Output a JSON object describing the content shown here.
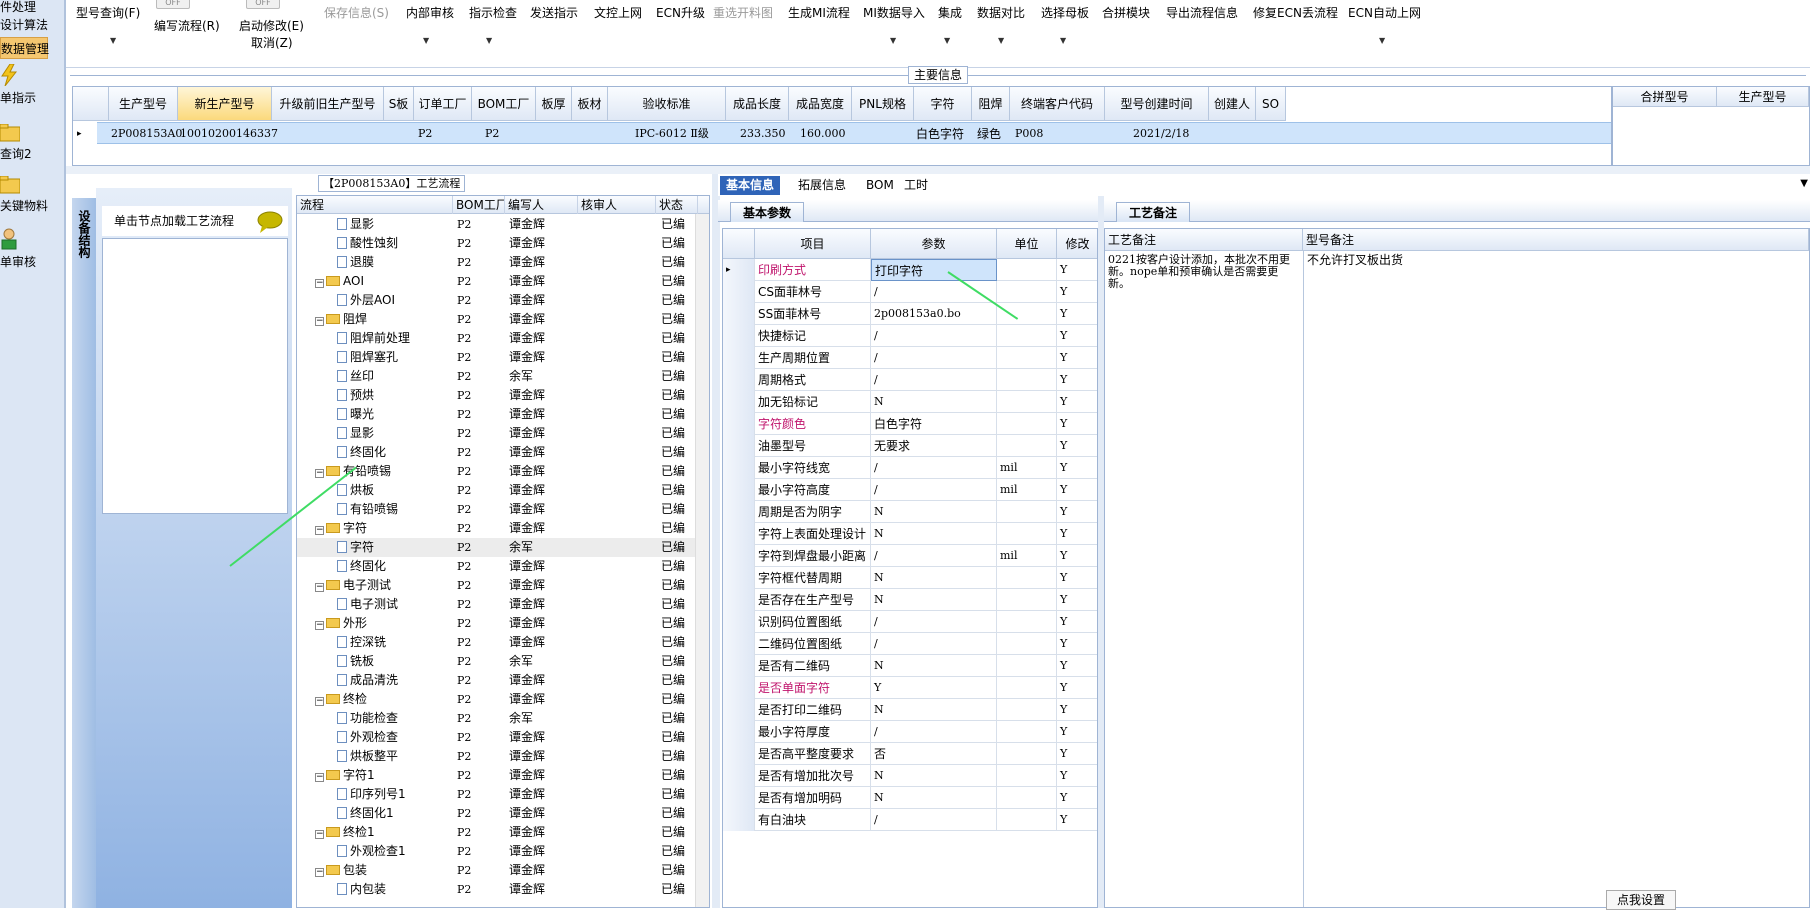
{
  "nav": {
    "items": [
      "件处理",
      "设计算法",
      "数据管理",
      "单指示",
      "查询2",
      "关键物料",
      "单审核"
    ]
  },
  "toolbar": {
    "buttons": [
      "型号查询(F)",
      "编写流程(R)",
      "启动修改(E)",
      "取消(Z)",
      "保存信息(S)",
      "内部审核",
      "指示检查",
      "发送指示",
      "文控上网",
      "ECN升级",
      "重选开料图",
      "生成MI流程",
      "MI数据导入",
      "集成",
      "数据对比",
      "选择母板",
      "合拼模块",
      "导出流程信息",
      "修复ECN丢流程",
      "ECN自动上网"
    ],
    "toggle": "OFF"
  },
  "main_info": {
    "title": "主要信息",
    "headers": [
      "生产型号",
      "新生产型号",
      "升级前旧生产型号",
      "S板",
      "订单工厂",
      "BOM工厂",
      "板厚",
      "板材",
      "验收标准",
      "成品长度",
      "成品宽度",
      "PNL规格",
      "字符",
      "阻焊",
      "终端客户代码",
      "型号创建时间",
      "创建人",
      "SO"
    ],
    "row": [
      "2P008153A0",
      "10010200146337",
      "",
      "",
      "P2",
      "P2",
      "",
      "",
      "IPC-6012 Ⅱ级",
      "233.350",
      "160.000",
      "",
      "白色字符",
      "绿色",
      "P008",
      "2021/2/18",
      "",
      ""
    ],
    "right_headers": [
      "合拼型号",
      "生产型号"
    ]
  },
  "left_panel": {
    "vertical_tab": "设备结构",
    "hint": "单击节点加载工艺流程"
  },
  "tree": {
    "caption": "【2P008153A0】工艺流程",
    "headers": [
      "流程",
      "BOM工厂",
      "编写人",
      "核审人",
      "状态"
    ],
    "rows": [
      {
        "level": 2,
        "type": "doc",
        "name": "显影",
        "bom": "P2",
        "writer": "谭金辉",
        "status": "已编"
      },
      {
        "level": 2,
        "type": "doc",
        "name": "酸性蚀刻",
        "bom": "P2",
        "writer": "谭金辉",
        "status": "已编"
      },
      {
        "level": 2,
        "type": "doc",
        "name": "退膜",
        "bom": "P2",
        "writer": "谭金辉",
        "status": "已编"
      },
      {
        "level": 1,
        "type": "folder",
        "name": "AOI",
        "bom": "P2",
        "writer": "谭金辉",
        "status": "已编"
      },
      {
        "level": 2,
        "type": "doc",
        "name": "外层AOI",
        "bom": "P2",
        "writer": "谭金辉",
        "status": "已编"
      },
      {
        "level": 1,
        "type": "folder",
        "name": "阻焊",
        "bom": "P2",
        "writer": "谭金辉",
        "status": "已编"
      },
      {
        "level": 2,
        "type": "doc",
        "name": "阻焊前处理",
        "bom": "P2",
        "writer": "谭金辉",
        "status": "已编"
      },
      {
        "level": 2,
        "type": "doc",
        "name": "阻焊塞孔",
        "bom": "P2",
        "writer": "谭金辉",
        "status": "已编"
      },
      {
        "level": 2,
        "type": "doc",
        "name": "丝印",
        "bom": "P2",
        "writer": "余军",
        "status": "已编"
      },
      {
        "level": 2,
        "type": "doc",
        "name": "预烘",
        "bom": "P2",
        "writer": "谭金辉",
        "status": "已编"
      },
      {
        "level": 2,
        "type": "doc",
        "name": "曝光",
        "bom": "P2",
        "writer": "谭金辉",
        "status": "已编"
      },
      {
        "level": 2,
        "type": "doc",
        "name": "显影",
        "bom": "P2",
        "writer": "谭金辉",
        "status": "已编"
      },
      {
        "level": 2,
        "type": "doc",
        "name": "终固化",
        "bom": "P2",
        "writer": "谭金辉",
        "status": "已编"
      },
      {
        "level": 1,
        "type": "folder",
        "name": "有铅喷锡",
        "bom": "P2",
        "writer": "谭金辉",
        "status": "已编"
      },
      {
        "level": 2,
        "type": "doc",
        "name": "烘板",
        "bom": "P2",
        "writer": "谭金辉",
        "status": "已编"
      },
      {
        "level": 2,
        "type": "doc",
        "name": "有铅喷锡",
        "bom": "P2",
        "writer": "谭金辉",
        "status": "已编"
      },
      {
        "level": 1,
        "type": "folder",
        "name": "字符",
        "bom": "P2",
        "writer": "谭金辉",
        "status": "已编"
      },
      {
        "level": 2,
        "type": "doc",
        "name": "字符",
        "bom": "P2",
        "writer": "余军",
        "status": "已编",
        "selected": true
      },
      {
        "level": 2,
        "type": "doc",
        "name": "终固化",
        "bom": "P2",
        "writer": "谭金辉",
        "status": "已编"
      },
      {
        "level": 1,
        "type": "folder",
        "name": "电子测试",
        "bom": "P2",
        "writer": "谭金辉",
        "status": "已编"
      },
      {
        "level": 2,
        "type": "doc",
        "name": "电子测试",
        "bom": "P2",
        "writer": "谭金辉",
        "status": "已编"
      },
      {
        "level": 1,
        "type": "folder",
        "name": "外形",
        "bom": "P2",
        "writer": "谭金辉",
        "status": "已编"
      },
      {
        "level": 2,
        "type": "doc",
        "name": "控深铣",
        "bom": "P2",
        "writer": "谭金辉",
        "status": "已编"
      },
      {
        "level": 2,
        "type": "doc",
        "name": "铣板",
        "bom": "P2",
        "writer": "余军",
        "status": "已编"
      },
      {
        "level": 2,
        "type": "doc",
        "name": "成品清洗",
        "bom": "P2",
        "writer": "谭金辉",
        "status": "已编"
      },
      {
        "level": 1,
        "type": "folder",
        "name": "终检",
        "bom": "P2",
        "writer": "谭金辉",
        "status": "已编"
      },
      {
        "level": 2,
        "type": "doc",
        "name": "功能检查",
        "bom": "P2",
        "writer": "余军",
        "status": "已编"
      },
      {
        "level": 2,
        "type": "doc",
        "name": "外观检查",
        "bom": "P2",
        "writer": "谭金辉",
        "status": "已编"
      },
      {
        "level": 2,
        "type": "doc",
        "name": "烘板整平",
        "bom": "P2",
        "writer": "谭金辉",
        "status": "已编"
      },
      {
        "level": 1,
        "type": "folder",
        "name": "字符1",
        "bom": "P2",
        "writer": "谭金辉",
        "status": "已编"
      },
      {
        "level": 2,
        "type": "doc",
        "name": "印序列号1",
        "bom": "P2",
        "writer": "谭金辉",
        "status": "已编"
      },
      {
        "level": 2,
        "type": "doc",
        "name": "终固化1",
        "bom": "P2",
        "writer": "谭金辉",
        "status": "已编"
      },
      {
        "level": 1,
        "type": "folder",
        "name": "终检1",
        "bom": "P2",
        "writer": "谭金辉",
        "status": "已编"
      },
      {
        "level": 2,
        "type": "doc",
        "name": "外观检查1",
        "bom": "P2",
        "writer": "谭金辉",
        "status": "已编"
      },
      {
        "level": 1,
        "type": "folder",
        "name": "包装",
        "bom": "P2",
        "writer": "谭金辉",
        "status": "已编"
      },
      {
        "level": 2,
        "type": "doc",
        "name": "内包装",
        "bom": "P2",
        "writer": "谭金辉",
        "status": "已编"
      }
    ]
  },
  "tabs": [
    "基本信息",
    "拓展信息",
    "BOM",
    "工时"
  ],
  "basic_params": {
    "title": "基本参数",
    "headers": [
      "项目",
      "参数",
      "单位",
      "修改"
    ],
    "rows": [
      {
        "item": "印刷方式",
        "value": "打印字符",
        "unit": "",
        "mod": "Y",
        "hl": true
      },
      {
        "item": "CS面菲林号",
        "value": "/",
        "unit": "",
        "mod": "Y"
      },
      {
        "item": "SS面菲林号",
        "value": "2p008153a0.bo",
        "unit": "",
        "mod": "Y"
      },
      {
        "item": "快捷标记",
        "value": "/",
        "unit": "",
        "mod": "Y"
      },
      {
        "item": "生产周期位置",
        "value": "/",
        "unit": "",
        "mod": "Y"
      },
      {
        "item": "周期格式",
        "value": "/",
        "unit": "",
        "mod": "Y"
      },
      {
        "item": "加无铅标记",
        "value": "N",
        "unit": "",
        "mod": "Y"
      },
      {
        "item": "字符颜色",
        "value": "白色字符",
        "unit": "",
        "mod": "Y",
        "hl": true
      },
      {
        "item": "油墨型号",
        "value": "无要求",
        "unit": "",
        "mod": "Y"
      },
      {
        "item": "最小字符线宽",
        "value": "/",
        "unit": "mil",
        "mod": "Y"
      },
      {
        "item": "最小字符高度",
        "value": "/",
        "unit": "mil",
        "mod": "Y"
      },
      {
        "item": "周期是否为阴字",
        "value": "N",
        "unit": "",
        "mod": "Y"
      },
      {
        "item": "字符上表面处理设计",
        "value": "N",
        "unit": "",
        "mod": "Y"
      },
      {
        "item": "字符到焊盘最小距离",
        "value": "/",
        "unit": "mil",
        "mod": "Y"
      },
      {
        "item": "字符框代替周期",
        "value": "N",
        "unit": "",
        "mod": "Y"
      },
      {
        "item": "是否存在生产型号",
        "value": "N",
        "unit": "",
        "mod": "Y"
      },
      {
        "item": "识别码位置图纸",
        "value": "/",
        "unit": "",
        "mod": "Y"
      },
      {
        "item": "二维码位置图纸",
        "value": "/",
        "unit": "",
        "mod": "Y"
      },
      {
        "item": "是否有二维码",
        "value": "N",
        "unit": "",
        "mod": "Y"
      },
      {
        "item": "是否单面字符",
        "value": "Y",
        "unit": "",
        "mod": "Y",
        "hl": true
      },
      {
        "item": "是否打印二维码",
        "value": "N",
        "unit": "",
        "mod": "Y"
      },
      {
        "item": "最小字符厚度",
        "value": "/",
        "unit": "",
        "mod": "Y"
      },
      {
        "item": "是否高平整度要求",
        "value": "否",
        "unit": "",
        "mod": "Y"
      },
      {
        "item": "是否有增加批次号",
        "value": "N",
        "unit": "",
        "mod": "Y"
      },
      {
        "item": "是否有增加明码",
        "value": "N",
        "unit": "",
        "mod": "Y"
      },
      {
        "item": "有白油块",
        "value": "/",
        "unit": "",
        "mod": "Y"
      }
    ]
  },
  "notes": {
    "title": "工艺备注",
    "col1_header": "工艺备注",
    "col2_header": "型号备注",
    "col1_text": "0221按客户设计添加，本批次不用更新。nope单和预审确认是否需要更新。",
    "col2_text": "不允许打叉板出货"
  },
  "point_button": "点我设置"
}
